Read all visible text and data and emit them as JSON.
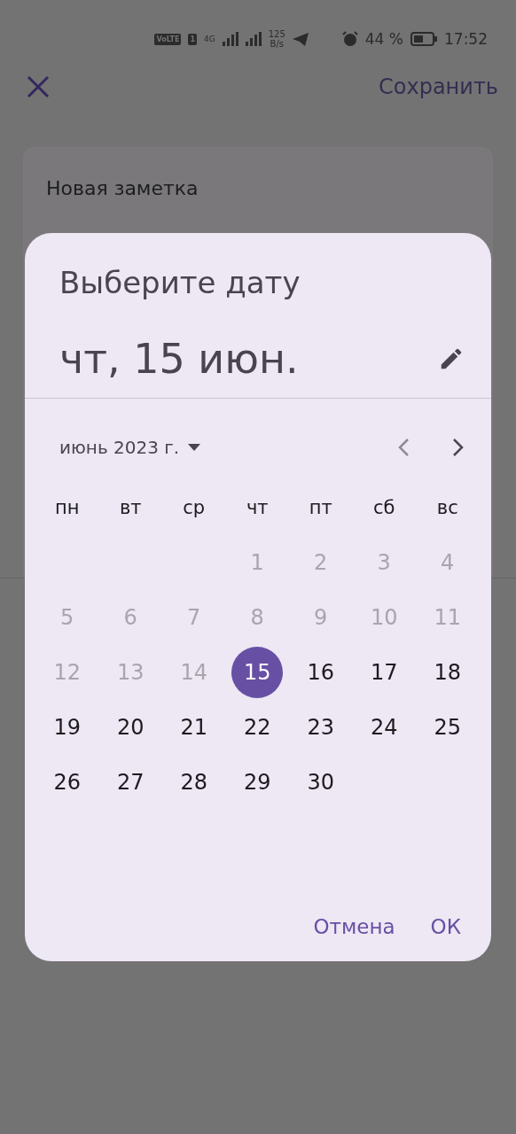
{
  "status_bar": {
    "volte": "VoLTE",
    "sim": "1",
    "network": "4G",
    "speed_value": "125",
    "speed_unit": "B/s",
    "battery": "44 %",
    "time": "17:52"
  },
  "app_bar": {
    "save": "Сохранить"
  },
  "note": {
    "title": "Новая заметка"
  },
  "dialog": {
    "title": "Выберите дату",
    "headline": "чт, 15 июн.",
    "month": "июнь 2023 г.",
    "weekdays": [
      "пн",
      "вт",
      "ср",
      "чт",
      "пт",
      "сб",
      "вс"
    ],
    "weeks": [
      [
        {
          "day": "1",
          "disabled": true,
          "selected": false
        },
        {
          "day": "2",
          "disabled": true,
          "selected": false
        },
        {
          "day": "3",
          "disabled": true,
          "selected": false
        },
        {
          "day": "4",
          "disabled": true,
          "selected": false
        }
      ],
      [
        {
          "day": "5",
          "disabled": true,
          "selected": false
        },
        {
          "day": "6",
          "disabled": true,
          "selected": false
        },
        {
          "day": "7",
          "disabled": true,
          "selected": false
        },
        {
          "day": "8",
          "disabled": true,
          "selected": false
        },
        {
          "day": "9",
          "disabled": true,
          "selected": false
        },
        {
          "day": "10",
          "disabled": true,
          "selected": false
        },
        {
          "day": "11",
          "disabled": true,
          "selected": false
        }
      ],
      [
        {
          "day": "12",
          "disabled": true,
          "selected": false
        },
        {
          "day": "13",
          "disabled": true,
          "selected": false
        },
        {
          "day": "14",
          "disabled": true,
          "selected": false
        },
        {
          "day": "15",
          "disabled": false,
          "selected": true
        },
        {
          "day": "16",
          "disabled": false,
          "selected": false
        },
        {
          "day": "17",
          "disabled": false,
          "selected": false
        },
        {
          "day": "18",
          "disabled": false,
          "selected": false
        }
      ],
      [
        {
          "day": "19",
          "disabled": false,
          "selected": false
        },
        {
          "day": "20",
          "disabled": false,
          "selected": false
        },
        {
          "day": "21",
          "disabled": false,
          "selected": false
        },
        {
          "day": "22",
          "disabled": false,
          "selected": false
        },
        {
          "day": "23",
          "disabled": false,
          "selected": false
        },
        {
          "day": "24",
          "disabled": false,
          "selected": false
        },
        {
          "day": "25",
          "disabled": false,
          "selected": false
        }
      ],
      [
        {
          "day": "26",
          "disabled": false,
          "selected": false
        },
        {
          "day": "27",
          "disabled": false,
          "selected": false
        },
        {
          "day": "28",
          "disabled": false,
          "selected": false
        },
        {
          "day": "29",
          "disabled": false,
          "selected": false
        },
        {
          "day": "30",
          "disabled": false,
          "selected": false
        }
      ]
    ],
    "buttons": [
      "Отмена",
      "ОК"
    ]
  }
}
